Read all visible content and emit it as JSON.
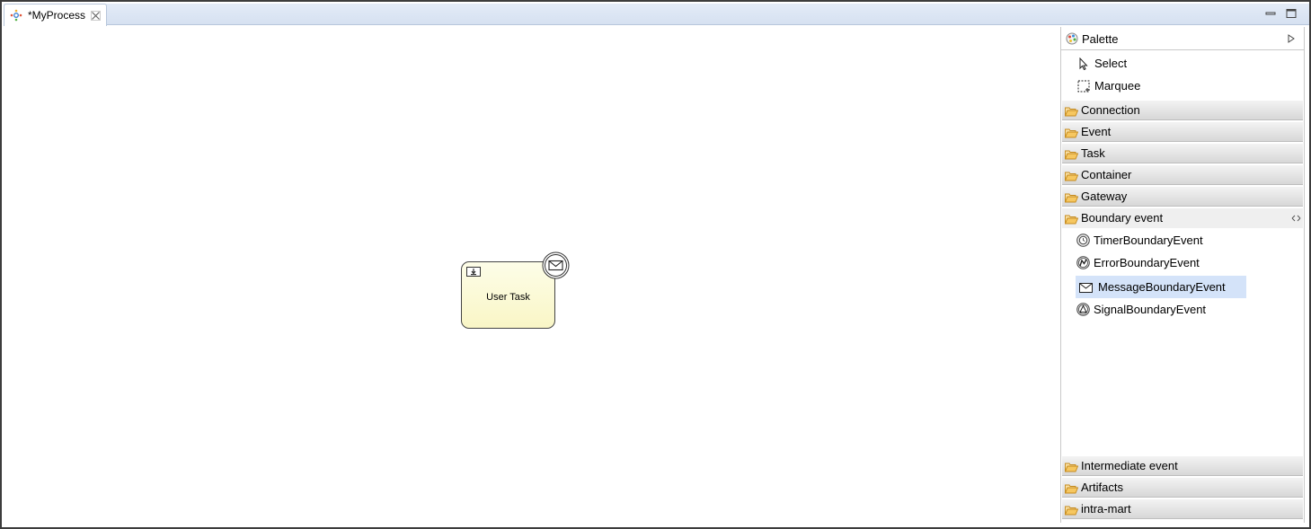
{
  "editor": {
    "tab_title": "*MyProcess"
  },
  "diagram": {
    "task_label": "User Task"
  },
  "palette": {
    "title": "Palette",
    "tools": [
      {
        "label": "Select",
        "icon": "pointer-icon"
      },
      {
        "label": "Marquee",
        "icon": "marquee-icon"
      }
    ],
    "drawers_top": [
      {
        "label": "Connection"
      },
      {
        "label": "Event"
      },
      {
        "label": "Task"
      },
      {
        "label": "Container"
      },
      {
        "label": "Gateway"
      }
    ],
    "open_drawer": {
      "label": "Boundary event",
      "entries": [
        {
          "label": "TimerBoundaryEvent",
          "icon": "timer-boundary-icon"
        },
        {
          "label": "ErrorBoundaryEvent",
          "icon": "error-boundary-icon"
        },
        {
          "label": "MessageBoundaryEvent",
          "icon": "message-boundary-icon",
          "selected": true
        },
        {
          "label": "SignalBoundaryEvent",
          "icon": "signal-boundary-icon"
        }
      ]
    },
    "drawers_bottom": [
      {
        "label": "Intermediate event"
      },
      {
        "label": "Artifacts"
      },
      {
        "label": "intra-mart"
      }
    ]
  },
  "colors": {
    "selection": "#d4e3f9",
    "task_fill": "#fdfde8",
    "folder": "#e8a93c"
  }
}
